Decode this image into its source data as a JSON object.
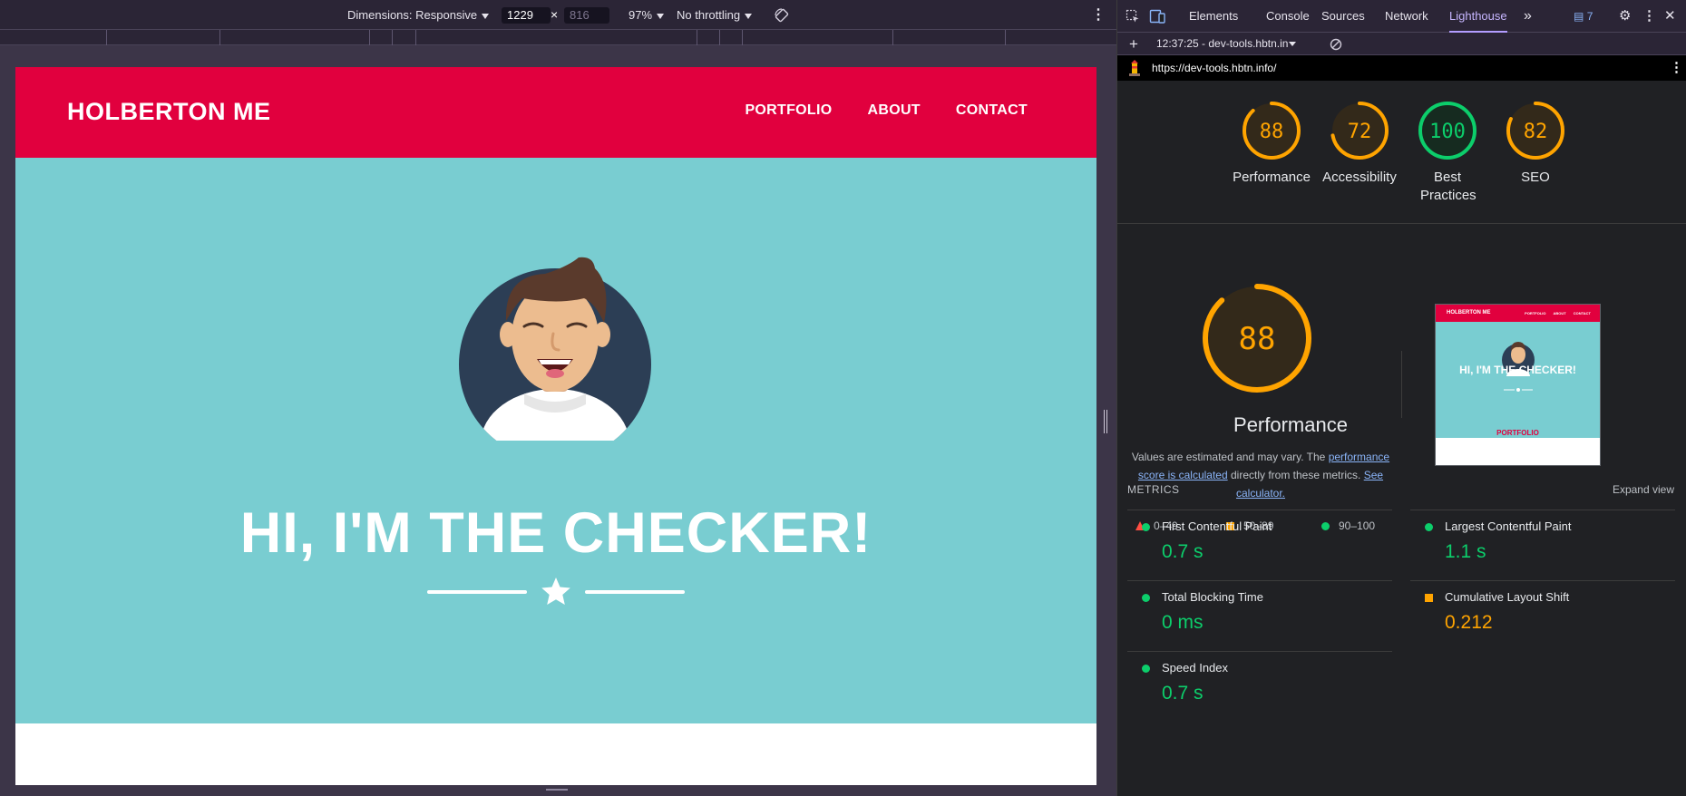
{
  "device_toolbar": {
    "dimensions_label": "Dimensions: Responsive",
    "width_value": "1229",
    "height_value": "816",
    "zoom": "97%",
    "throttling": "No throttling"
  },
  "site": {
    "logo": "HOLBERTON ME",
    "nav": [
      "PORTFOLIO",
      "ABOUT",
      "CONTACT"
    ],
    "hero_title": "HI, I'M THE CHECKER!"
  },
  "devtools": {
    "tabs": [
      "Elements",
      "Console",
      "Sources",
      "Network",
      "Lighthouse"
    ],
    "active_tab": "Lighthouse",
    "issues_count": "7",
    "report_label": "12:37:25 - dev-tools.hbtn.in",
    "url": "https://dev-tools.hbtn.info/"
  },
  "lighthouse": {
    "scores": [
      {
        "label": "Performance",
        "value": "88",
        "fraction": 0.88,
        "color": "#ffa400"
      },
      {
        "label": "Accessibility",
        "value": "72",
        "fraction": 0.72,
        "color": "#ffa400"
      },
      {
        "label": "Best Practices",
        "value": "100",
        "fraction": 1.0,
        "color": "#0cce6b"
      },
      {
        "label": "SEO",
        "value": "82",
        "fraction": 0.82,
        "color": "#ffa400"
      }
    ],
    "performance": {
      "score": "88",
      "fraction": 0.88,
      "title": "Performance",
      "desc_before": "Values are estimated and may vary. The",
      "desc_link": "performance score is calculated",
      "desc_after": "directly from these metrics.",
      "calc_link": "See calculator."
    },
    "legend": [
      "0–49",
      "50–89",
      "90–100"
    ],
    "thumbnail": {
      "logo": "HOLBERTON ME",
      "nav": [
        "PORTFOLIO",
        "ABOUT",
        "CONTACT"
      ],
      "title": "HI, I'M THE CHECKER!",
      "section": "PORTFOLIO"
    },
    "metrics_heading": "METRICS",
    "expand_label": "Expand view",
    "metrics": [
      {
        "name": "First Contentful Paint",
        "value": "0.7 s",
        "status": "good"
      },
      {
        "name": "Largest Contentful Paint",
        "value": "1.1 s",
        "status": "good"
      },
      {
        "name": "Total Blocking Time",
        "value": "0 ms",
        "status": "good"
      },
      {
        "name": "Cumulative Layout Shift",
        "value": "0.212",
        "status": "average"
      },
      {
        "name": "Speed Index",
        "value": "0.7 s",
        "status": "good"
      }
    ]
  }
}
